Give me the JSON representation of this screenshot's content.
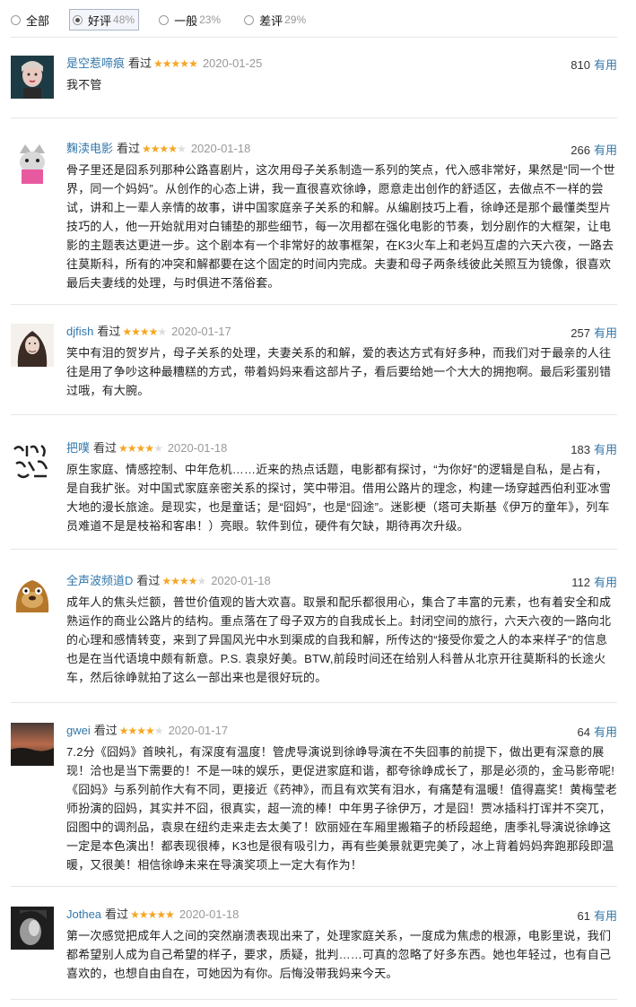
{
  "filters": [
    {
      "label": "全部",
      "pct": "",
      "active": false
    },
    {
      "label": "好评",
      "pct": "48%",
      "active": true
    },
    {
      "label": "一般",
      "pct": "23%",
      "active": false
    },
    {
      "label": "差评",
      "pct": "29%",
      "active": false
    }
  ],
  "useful_label": "有用",
  "watched_label": "看过",
  "reviews": [
    {
      "author": "是空惹啼痕",
      "rating": 5,
      "date": "2020-01-25",
      "votes": "810",
      "avatar_icon": "woman-portrait-avatar",
      "text": "我不管"
    },
    {
      "author": "麴渎电影",
      "rating": 4,
      "date": "2020-01-18",
      "votes": "266",
      "avatar_icon": "cat-mask-avatar",
      "text": "骨子里还是囧系列那种公路喜剧片，这次用母子关系制造一系列的笑点，代入感非常好，果然是“同一个世界，同一个妈妈”。从创作的心态上讲，我一直很喜欢徐峥，愿意走出创作的舒适区，去做点不一样的尝试，讲和上一辈人亲情的故事，讲中国家庭亲子关系的和解。从编剧技巧上看，徐峥还是那个最懂类型片技巧的人，他一开始就用对白铺垫的那些细节，每一次用都在强化电影的节奏，划分剧作的大框架，让电影的主题表达更进一步。这个剧本有一个非常好的故事框架，在K3火车上和老妈互虐的六天六夜，一路去往莫斯科，所有的冲突和解都要在这个固定的时间内完成。夫妻和母子两条线彼此关照互为镜像，很喜欢最后夫妻线的处理，与时俱进不落俗套。"
    },
    {
      "author": "djfish",
      "rating": 4,
      "date": "2020-01-17",
      "votes": "257",
      "avatar_icon": "drawn-woman-avatar",
      "text": "笑中有泪的贺岁片，母子关系的处理，夫妻关系的和解，爱的表达方式有好多种，而我们对于最亲的人往往是用了争吵这种最糟糕的方式，带着妈妈来看这部片子，看后要给她一个大大的拥抱啊。最后彩蛋别错过哦，有大腕。"
    },
    {
      "author": "把噗",
      "rating": 4,
      "date": "2020-01-18",
      "votes": "183",
      "avatar_icon": "calligraphy-avatar",
      "text": "原生家庭、情感控制、中年危机……近来的热点话题，电影都有探讨，“为你好”的逻辑是自私，是占有，是自我扩张。对中国式家庭亲密关系的探讨，笑中带泪。借用公路片的理念，构建一场穿越西伯利亚冰雪大地的漫长旅途。是现实，也是童话；是“囧妈”，也是“囧途”。迷影梗（塔可夫斯基《伊万的童年》，列车员难道不是是枝裕和客串！）亮眼。软件到位，硬件有欠缺，期待再次升级。"
    },
    {
      "author": "全声波频道D",
      "rating": 4,
      "date": "2020-01-18",
      "votes": "112",
      "avatar_icon": "cartoon-animal-avatar",
      "text": "成年人的焦头烂额，普世价值观的皆大欢喜。取景和配乐都很用心，集合了丰富的元素，也有着安全和成熟运作的商业公路片的结构。重点落在了母子双方的自我成长上。封闭空间的旅行，六天六夜的一路向北的心理和感情转变，来到了异国风光中水到渠成的自我和解，所传达的“接受你爱之人的本来样子”的信息也是在当代语境中颇有新意。P.S. 袁泉好美。BTW,前段时间还在给别人科普从北京开往莫斯科的长途火车，然后徐峥就拍了这么一部出来也是很好玩的。"
    },
    {
      "author": "gwei",
      "rating": 4,
      "date": "2020-01-17",
      "votes": "64",
      "avatar_icon": "sunset-landscape-avatar",
      "text": "7.2分《囧妈》首映礼，有深度有温度！管虎导演说到徐峥导演在不失囧事的前提下，做出更有深意的展现！洽也是当下需要的！不是一味的娱乐，更促进家庭和谐，都夸徐峥成长了，那是必须的，金马影帝呢!《囧妈》与系列前作大有不同，更接近《药神》，而且有欢笑有泪水，有痛楚有温暖！值得嘉奖！黄梅莹老师扮演的囧妈，其实并不囧，很真实，超一流的棒！中年男子徐伊万，才是囧！贾冰插科打诨并不突兀，囧图中的调剂品，袁泉在纽约走来走去太美了！欧丽娅在车厢里搬箱子的桥段超绝，唐季礼导演说徐峥这一定是本色演出！都表现很棒，K3也是很有吸引力，再有些美景就更完美了，冰上背着妈妈奔跑那段即温暖，又很美！相信徐峥未来在导演奖项上一定大有作为！"
    },
    {
      "author": "Jothea",
      "rating": 5,
      "date": "2020-01-18",
      "votes": "61",
      "avatar_icon": "grayscale-portrait-avatar",
      "text": "第一次感觉把成年人之间的突然崩溃表现出来了，处理家庭关系，一度成为焦虑的根源，电影里说，我们都希望别人成为自己希望的样子，要求，质疑，批判……可真的忽略了好多东西。她也年轻过，也有自己喜欢的，也想自由自在，可她因为有你。后悔没带我妈来今天。"
    }
  ]
}
